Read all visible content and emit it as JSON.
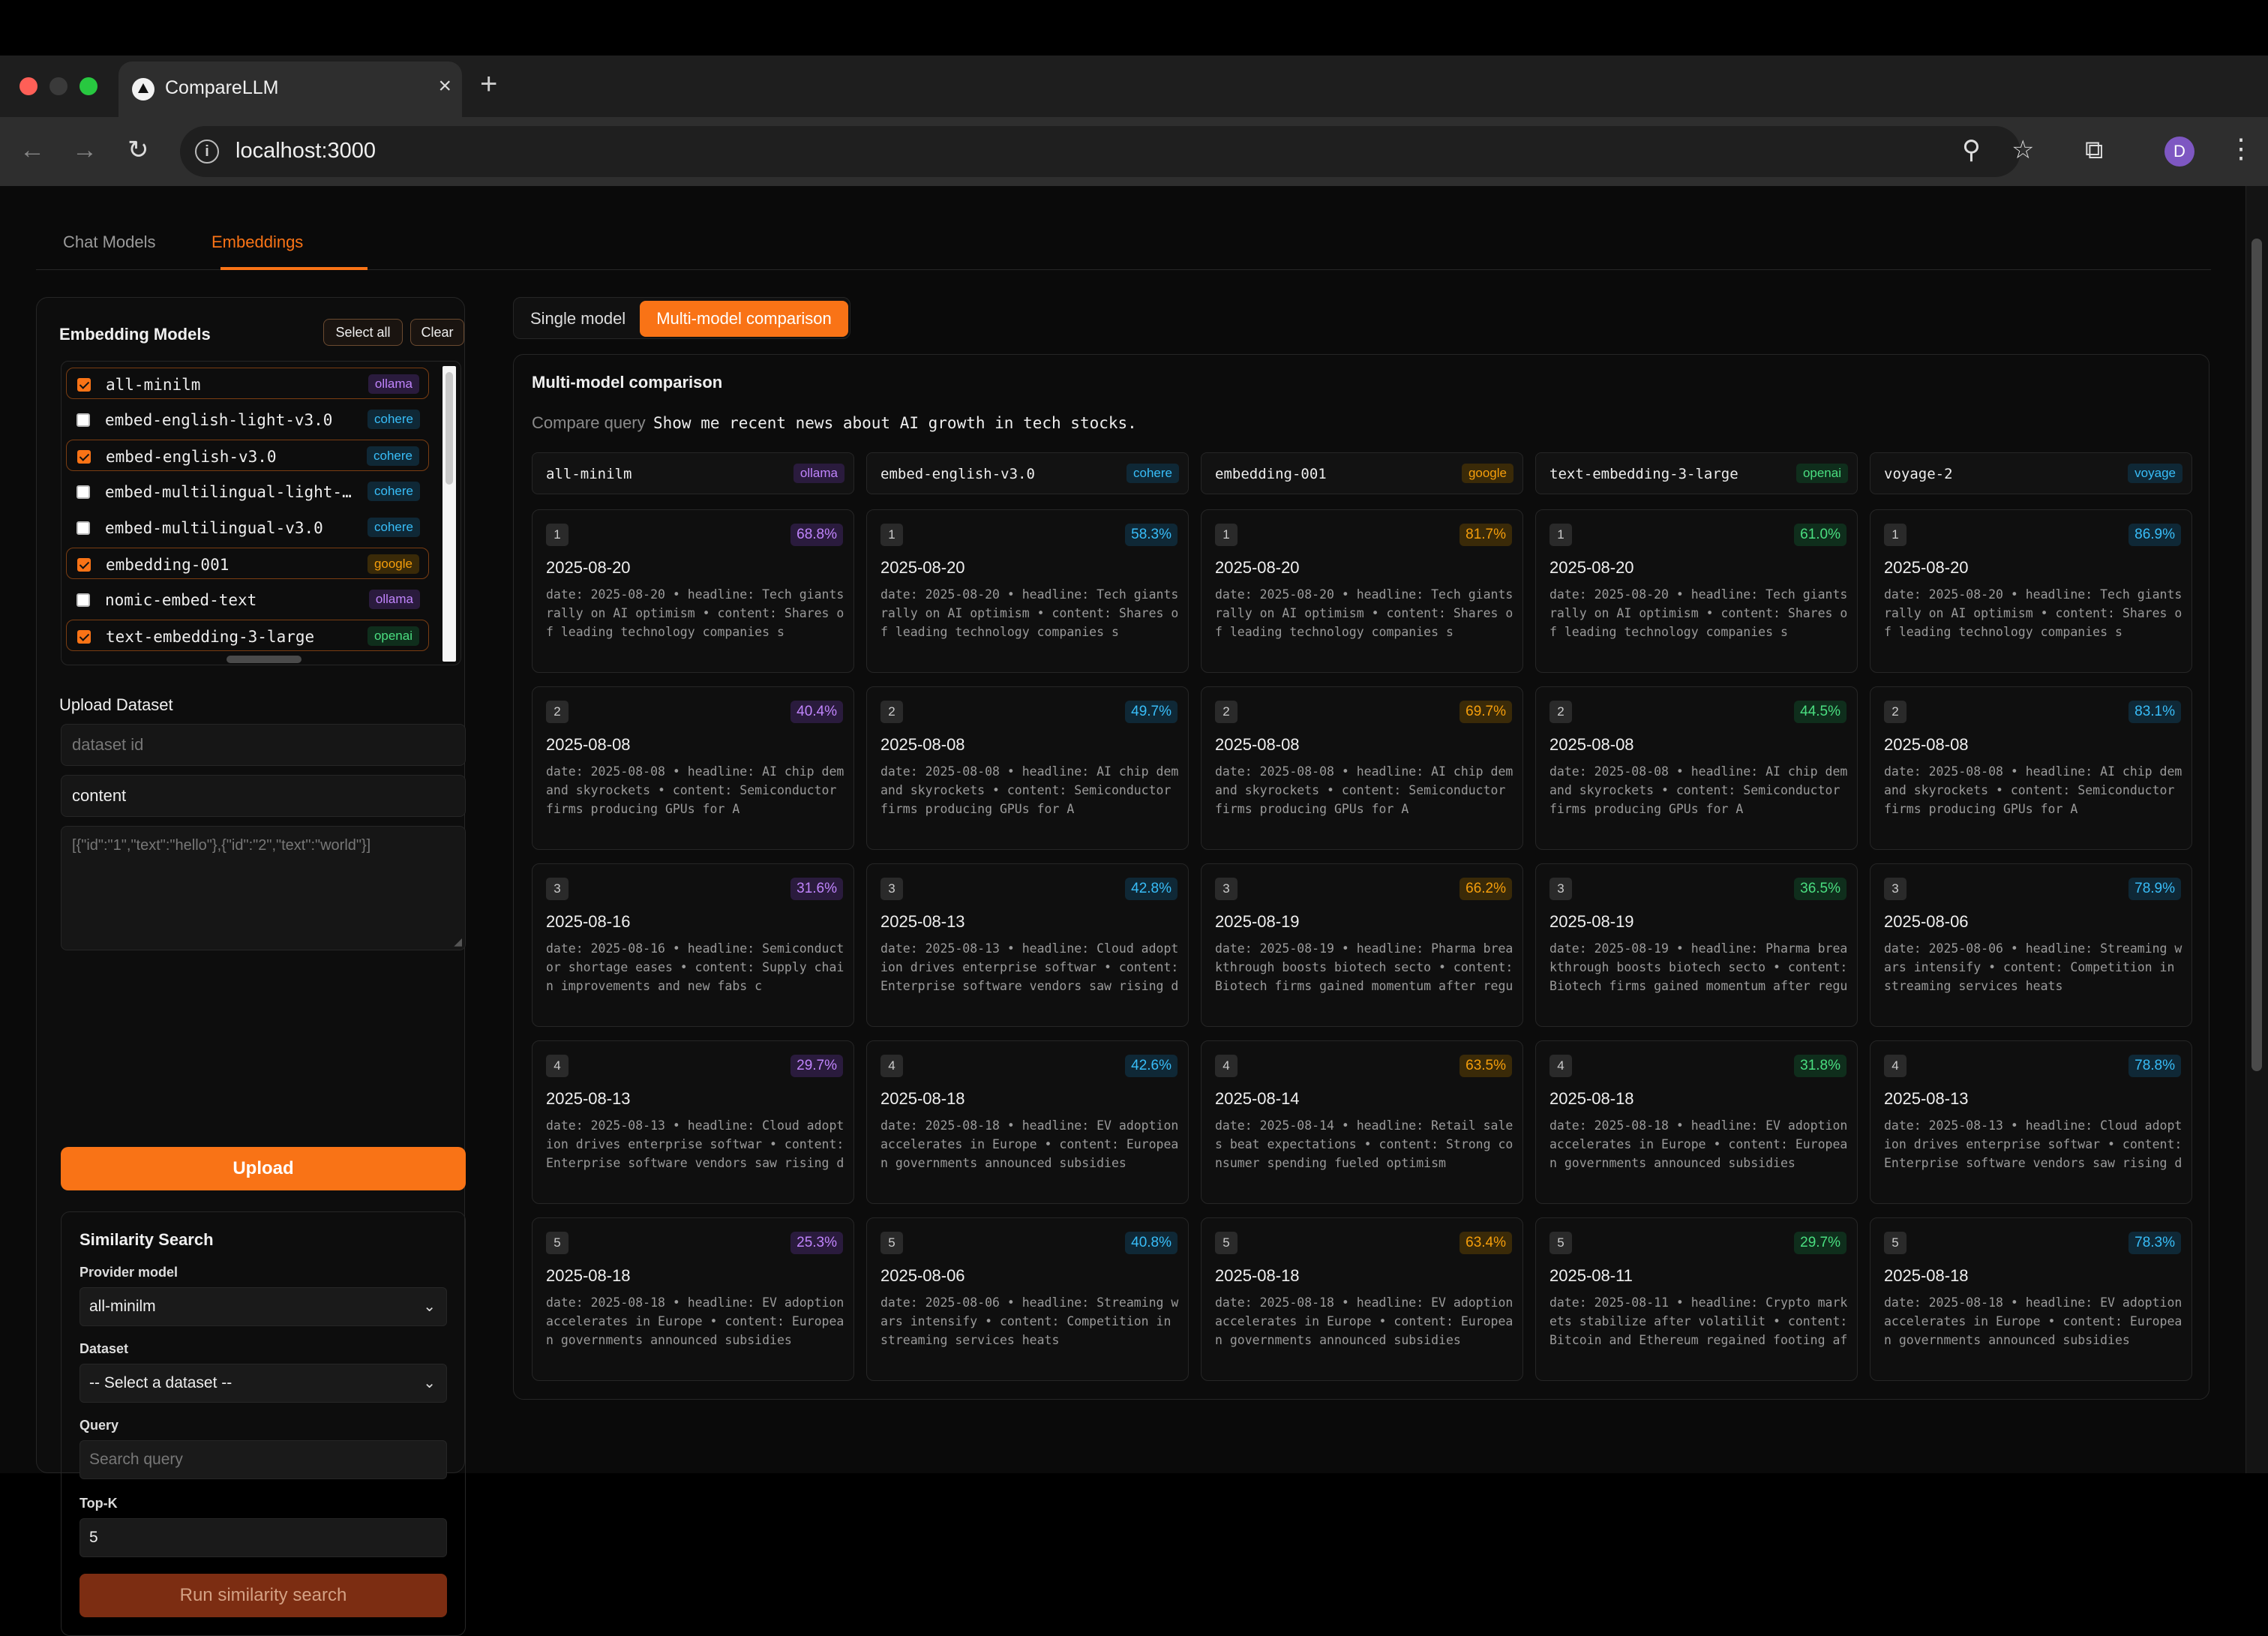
{
  "browser": {
    "tab_title": "CompareLLM",
    "url": "localhost:3000",
    "profile_initial": "D"
  },
  "icons": {
    "close": "×",
    "new_tab": "+",
    "back": "←",
    "forward": "→",
    "reload": "↻",
    "info": "i",
    "zoom": "⚲",
    "star": "☆",
    "cast": "⧉",
    "menu": "⋮",
    "chevron": "⌄"
  },
  "page_tabs": [
    "Chat Models",
    "Embeddings"
  ],
  "sidebar": {
    "title": "Embedding Models",
    "select_all": "Select all",
    "clear": "Clear",
    "models": [
      {
        "name": "all-minilm",
        "provider": "ollama",
        "checked": true
      },
      {
        "name": "embed-english-light-v3.0",
        "provider": "cohere",
        "checked": false
      },
      {
        "name": "embed-english-v3.0",
        "provider": "cohere",
        "checked": true
      },
      {
        "name": "embed-multilingual-light-…",
        "provider": "cohere",
        "checked": false
      },
      {
        "name": "embed-multilingual-v3.0",
        "provider": "cohere",
        "checked": false
      },
      {
        "name": "embedding-001",
        "provider": "google",
        "checked": true
      },
      {
        "name": "nomic-embed-text",
        "provider": "ollama",
        "checked": false
      },
      {
        "name": "text-embedding-3-large",
        "provider": "openai",
        "checked": true
      }
    ],
    "upload": {
      "title": "Upload Dataset",
      "dataset_id_placeholder": "dataset id",
      "field_value": "content",
      "json_placeholder": "[{\"id\":\"1\",\"text\":\"hello\"},{\"id\":\"2\",\"text\":\"world\"}]",
      "button": "Upload"
    },
    "similarity": {
      "title": "Similarity Search",
      "provider_label": "Provider model",
      "provider_value": "all-minilm",
      "dataset_label": "Dataset",
      "dataset_value": "-- Select a dataset --",
      "query_label": "Query",
      "query_placeholder": "Search query",
      "topk_label": "Top-K",
      "topk_value": "5",
      "run_button": "Run similarity search"
    }
  },
  "mode": {
    "single": "Single model",
    "multi": "Multi-model comparison"
  },
  "comparison": {
    "title": "Multi-model comparison",
    "query_label": "Compare query",
    "query": "Show me recent news about AI growth in tech stocks.",
    "columns": [
      {
        "model": "all-minilm",
        "provider": "ollama",
        "score_color": "#c084fc",
        "score_bg": "#2a1b3d",
        "results": [
          {
            "rank": "1",
            "score": "68.8%",
            "date": "2025-08-20",
            "snippet": "date: 2025-08-20 • headline: Tech giants rally on AI optimism • content: Shares of leading technology companies s"
          },
          {
            "rank": "2",
            "score": "40.4%",
            "date": "2025-08-08",
            "snippet": "date: 2025-08-08 • headline: AI chip demand skyrockets • content: Semiconductor firms producing GPUs for A"
          },
          {
            "rank": "3",
            "score": "31.6%",
            "date": "2025-08-16",
            "snippet": "date: 2025-08-16 • headline: Semiconductor shortage eases • content: Supply chain improvements and new fabs c"
          },
          {
            "rank": "4",
            "score": "29.7%",
            "date": "2025-08-13",
            "snippet": "date: 2025-08-13 • headline: Cloud adoption drives enterprise softwar • content: Enterprise software vendors saw rising d"
          },
          {
            "rank": "5",
            "score": "25.3%",
            "date": "2025-08-18",
            "snippet": "date: 2025-08-18 • headline: EV adoption accelerates in Europe • content: European governments announced subsidies"
          }
        ]
      },
      {
        "model": "embed-english-v3.0",
        "provider": "cohere",
        "score_color": "#38bdf8",
        "score_bg": "#0f2836",
        "results": [
          {
            "rank": "1",
            "score": "58.3%",
            "date": "2025-08-20",
            "snippet": "date: 2025-08-20 • headline: Tech giants rally on AI optimism • content: Shares of leading technology companies s"
          },
          {
            "rank": "2",
            "score": "49.7%",
            "date": "2025-08-08",
            "snippet": "date: 2025-08-08 • headline: AI chip demand skyrockets • content: Semiconductor firms producing GPUs for A"
          },
          {
            "rank": "3",
            "score": "42.8%",
            "date": "2025-08-13",
            "snippet": "date: 2025-08-13 • headline: Cloud adoption drives enterprise softwar • content: Enterprise software vendors saw rising d"
          },
          {
            "rank": "4",
            "score": "42.6%",
            "date": "2025-08-18",
            "snippet": "date: 2025-08-18 • headline: EV adoption accelerates in Europe • content: European governments announced subsidies"
          },
          {
            "rank": "5",
            "score": "40.8%",
            "date": "2025-08-06",
            "snippet": "date: 2025-08-06 • headline: Streaming wars intensify • content: Competition in streaming services heats"
          }
        ]
      },
      {
        "model": "embedding-001",
        "provider": "google",
        "score_color": "#f59e0b",
        "score_bg": "#3a2a08",
        "results": [
          {
            "rank": "1",
            "score": "81.7%",
            "date": "2025-08-20",
            "snippet": "date: 2025-08-20 • headline: Tech giants rally on AI optimism • content: Shares of leading technology companies s"
          },
          {
            "rank": "2",
            "score": "69.7%",
            "date": "2025-08-08",
            "snippet": "date: 2025-08-08 • headline: AI chip demand skyrockets • content: Semiconductor firms producing GPUs for A"
          },
          {
            "rank": "3",
            "score": "66.2%",
            "date": "2025-08-19",
            "snippet": "date: 2025-08-19 • headline: Pharma breakthrough boosts biotech secto • content: Biotech firms gained momentum after regu"
          },
          {
            "rank": "4",
            "score": "63.5%",
            "date": "2025-08-14",
            "snippet": "date: 2025-08-14 • headline: Retail sales beat expectations • content: Strong consumer spending fueled optimism"
          },
          {
            "rank": "5",
            "score": "63.4%",
            "date": "2025-08-18",
            "snippet": "date: 2025-08-18 • headline: EV adoption accelerates in Europe • content: European governments announced subsidies"
          }
        ]
      },
      {
        "model": "text-embedding-3-large",
        "provider": "openai",
        "score_color": "#4ade80",
        "score_bg": "#0f2e1c",
        "results": [
          {
            "rank": "1",
            "score": "61.0%",
            "date": "2025-08-20",
            "snippet": "date: 2025-08-20 • headline: Tech giants rally on AI optimism • content: Shares of leading technology companies s"
          },
          {
            "rank": "2",
            "score": "44.5%",
            "date": "2025-08-08",
            "snippet": "date: 2025-08-08 • headline: AI chip demand skyrockets • content: Semiconductor firms producing GPUs for A"
          },
          {
            "rank": "3",
            "score": "36.5%",
            "date": "2025-08-19",
            "snippet": "date: 2025-08-19 • headline: Pharma breakthrough boosts biotech secto • content: Biotech firms gained momentum after regu"
          },
          {
            "rank": "4",
            "score": "31.8%",
            "date": "2025-08-18",
            "snippet": "date: 2025-08-18 • headline: EV adoption accelerates in Europe • content: European governments announced subsidies"
          },
          {
            "rank": "5",
            "score": "29.7%",
            "date": "2025-08-11",
            "snippet": "date: 2025-08-11 • headline: Crypto markets stabilize after volatilit • content: Bitcoin and Ethereum regained footing af"
          }
        ]
      },
      {
        "model": "voyage-2",
        "provider": "voyage",
        "score_color": "#38bdf8",
        "score_bg": "#0f2836",
        "results": [
          {
            "rank": "1",
            "score": "86.9%",
            "date": "2025-08-20",
            "snippet": "date: 2025-08-20 • headline: Tech giants rally on AI optimism • content: Shares of leading technology companies s"
          },
          {
            "rank": "2",
            "score": "83.1%",
            "date": "2025-08-08",
            "snippet": "date: 2025-08-08 • headline: AI chip demand skyrockets • content: Semiconductor firms producing GPUs for A"
          },
          {
            "rank": "3",
            "score": "78.9%",
            "date": "2025-08-06",
            "snippet": "date: 2025-08-06 • headline: Streaming wars intensify • content: Competition in streaming services heats"
          },
          {
            "rank": "4",
            "score": "78.8%",
            "date": "2025-08-13",
            "snippet": "date: 2025-08-13 • headline: Cloud adoption drives enterprise softwar • content: Enterprise software vendors saw rising d"
          },
          {
            "rank": "5",
            "score": "78.3%",
            "date": "2025-08-18",
            "snippet": "date: 2025-08-18 • headline: EV adoption accelerates in Europe • content: European governments announced subsidies"
          }
        ]
      }
    ]
  }
}
